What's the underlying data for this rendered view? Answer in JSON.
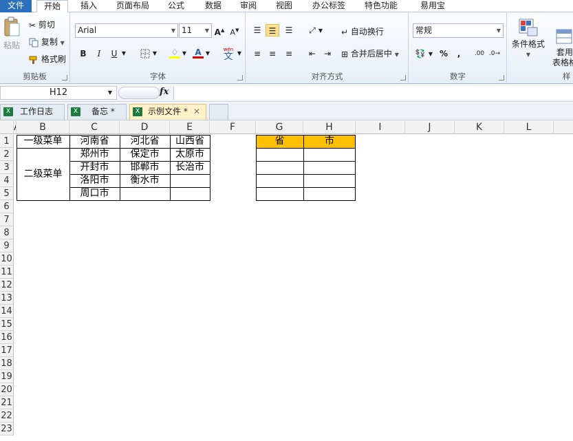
{
  "ribbon_tabs": [
    "文件",
    "开始",
    "插入",
    "页面布局",
    "公式",
    "数据",
    "审阅",
    "视图",
    "办公标签",
    "特色功能",
    "易用宝"
  ],
  "clipboard": {
    "paste": "粘贴",
    "cut": "剪切",
    "copy": "复制",
    "format_painter": "格式刷",
    "label": "剪贴板"
  },
  "font": {
    "name": "Arial",
    "size": "11",
    "label": "字体",
    "bold": "B",
    "italic": "I",
    "underline": "U",
    "color_letter": "A",
    "wen_small": "wén",
    "wen_big": "文"
  },
  "alignment": {
    "wrap": "自动换行",
    "merge": "合并后居中",
    "label": "对齐方式"
  },
  "number": {
    "format": "常规",
    "percent": "%",
    "comma": ",",
    "inc_decimal": ".00",
    "label": "数字"
  },
  "styles": {
    "conditional": "条件格式",
    "table_format": "套用\n表格格",
    "label": "样"
  },
  "formula_bar": {
    "name_box": "H12",
    "fx": "fx",
    "formula": ""
  },
  "doc_tabs": [
    "工作日志",
    "备忘 *",
    "示例文件 *"
  ],
  "columns": [
    "A",
    "B",
    "C",
    "D",
    "E",
    "F",
    "G",
    "H",
    "I",
    "J",
    "K",
    "L"
  ],
  "rows": [
    "1",
    "2",
    "3",
    "4",
    "5",
    "6",
    "7",
    "8",
    "9",
    "10",
    "11",
    "12",
    "13",
    "14",
    "15",
    "16",
    "17",
    "18",
    "19",
    "20",
    "21",
    "22",
    "23"
  ],
  "table1": {
    "b1": "一级菜单",
    "b_merged": "二级菜单",
    "headers": [
      "河南省",
      "河北省",
      "山西省"
    ],
    "col_c": [
      "郑州市",
      "开封市",
      "洛阳市",
      "周口市"
    ],
    "col_d": [
      "保定市",
      "邯郸市",
      "衡水市",
      ""
    ],
    "col_e": [
      "太原市",
      "长治市",
      "",
      ""
    ]
  },
  "table2": {
    "headers": [
      "省",
      "市"
    ],
    "header_color": "#ffc000"
  }
}
